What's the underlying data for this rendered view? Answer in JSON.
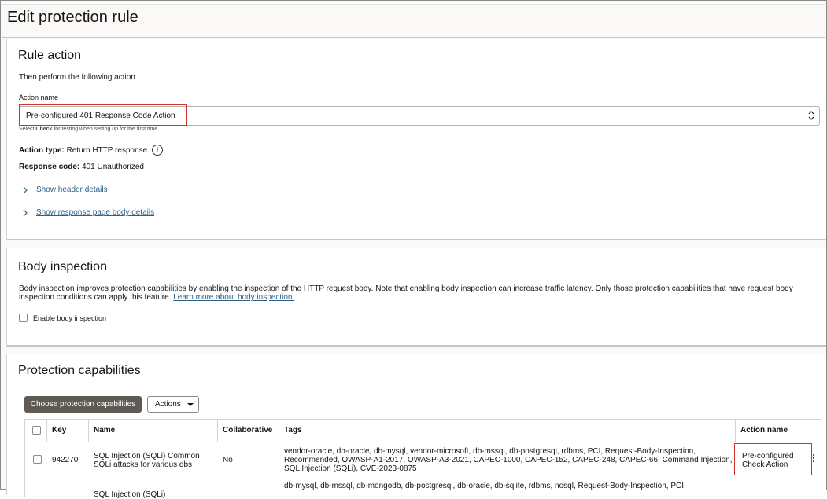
{
  "page": {
    "title": "Edit protection rule"
  },
  "rule_action": {
    "heading": "Rule action",
    "intro": "Then perform the following action.",
    "action_name_label": "Action name",
    "action_name_value": "Pre-configured 401 Response Code Action",
    "hint_prefix": "Select ",
    "hint_bold": "Check",
    "hint_suffix": " for testing when setting up for the first time.",
    "action_type_label": "Action type:",
    "action_type_value": "Return HTTP response",
    "response_code_label": "Response code:",
    "response_code_value": "401 Unauthorized",
    "show_header_details": "Show header details",
    "show_response_body": "Show response page body details"
  },
  "body_inspection": {
    "heading": "Body inspection",
    "description_line1": "Body inspection improves protection capabilities by enabling the inspection of the HTTP request body. Note that enabling body inspection can increase traffic latency. Only those protection capabilities that have request body",
    "description_line2": "inspection conditions can apply this feature. ",
    "learn_more": "Learn more about body inspection.",
    "enable_label": "Enable body inspection",
    "enable_checked": false
  },
  "protection_capabilities": {
    "heading": "Protection capabilities",
    "choose_button": "Choose protection capabilities",
    "actions_button": "Actions",
    "columns": [
      "Key",
      "Name",
      "Collaborative",
      "Tags",
      "Action name"
    ],
    "rows": [
      {
        "key": "942270",
        "name_line1": "SQL Injection (SQLi) Common",
        "name_line2": "SQLi attacks for various dbs",
        "collaborative": "No",
        "tags_line1": "vendor-oracle, db-oracle, db-mysql, vendor-microsoft, db-mssql, db-postgresql, rdbms, PCI, Request-Body-Inspection,",
        "tags_line2": "Recommended, OWASP-A1-2017, OWASP-A3-2021, CAPEC-1000, CAPEC-152, CAPEC-248, CAPEC-66, Command Injection,",
        "tags_line3": "SQL Injection (SQLi), CVE-2023-0875",
        "action_line1": "Pre-configured",
        "action_line2": "Check Action"
      },
      {
        "name_line1": "SQL Injection (SQLi)",
        "tags_line1": "db-mysql, db-mssql, db-mongodb, db-postgresql, db-oracle, db-sqlite, rdbms, nosql, Request-Body-Inspection, PCI,"
      }
    ]
  },
  "colors": {
    "highlight": "#d0312d",
    "link": "#2c5f83",
    "primary_button": "#5f5a54"
  }
}
